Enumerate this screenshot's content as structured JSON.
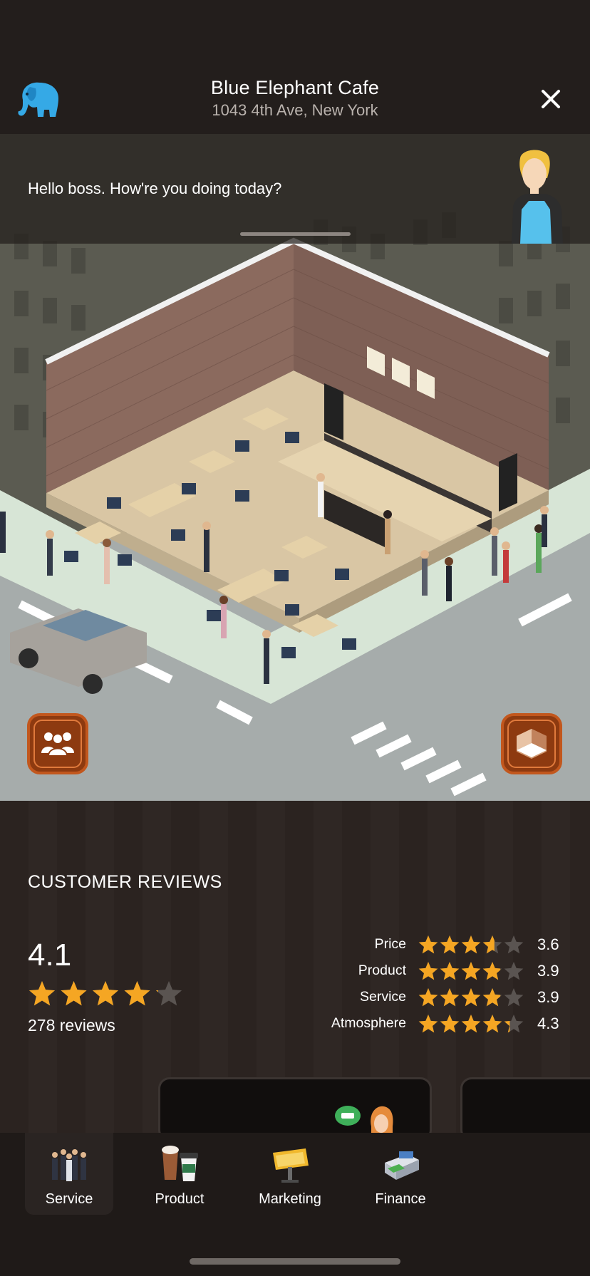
{
  "header": {
    "title": "Blue Elephant Cafe",
    "subtitle": "1043 4th Ave, New York",
    "logo_icon": "elephant-logo-icon",
    "close_icon": "close-icon"
  },
  "speech": {
    "message": "Hello boss. How're you doing today?"
  },
  "scene": {
    "left_button_icon": "staff-group-icon",
    "right_button_icon": "layout-box-icon"
  },
  "reviews": {
    "heading": "CUSTOMER REVIEWS",
    "overall_rating": "4.1",
    "overall_stars": 4.1,
    "count_label": "278 reviews",
    "categories": [
      {
        "label": "Price",
        "value": "3.6",
        "stars": 3.6
      },
      {
        "label": "Product",
        "value": "3.9",
        "stars": 3.9
      },
      {
        "label": "Service",
        "value": "3.9",
        "stars": 3.9
      },
      {
        "label": "Atmosphere",
        "value": "4.3",
        "stars": 4.3
      }
    ]
  },
  "tabs": [
    {
      "label": "Service",
      "icon": "staff-people-icon",
      "active": true
    },
    {
      "label": "Product",
      "icon": "coffee-cups-icon",
      "active": false
    },
    {
      "label": "Marketing",
      "icon": "billboard-icon",
      "active": false
    },
    {
      "label": "Finance",
      "icon": "cash-counter-icon",
      "active": false
    }
  ],
  "colors": {
    "star": "#f5a623",
    "star_empty": "#5a5451",
    "accent_button": "#8d3a10",
    "elephant_blue": "#35a9e6"
  }
}
